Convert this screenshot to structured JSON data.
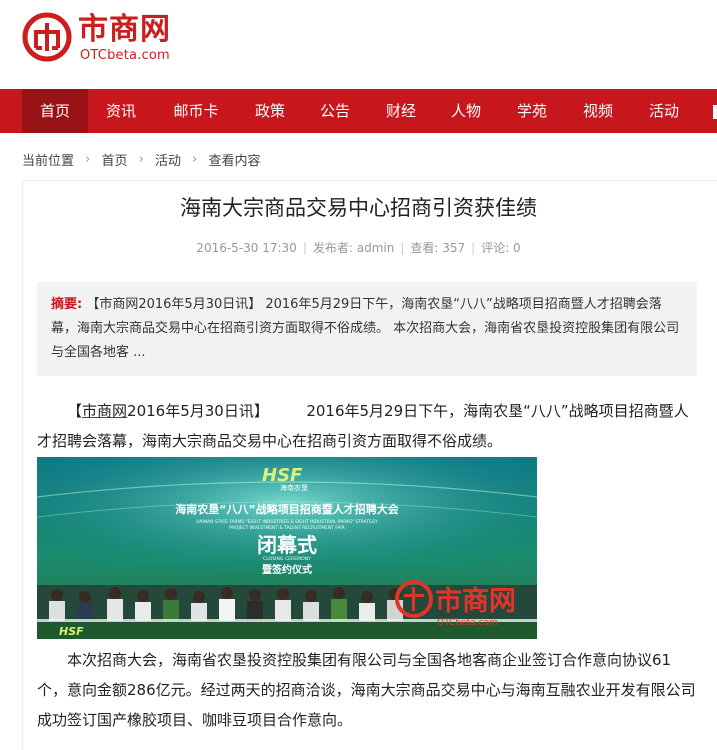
{
  "header": {
    "logo_text": "市商网",
    "logo_domain": "OTCbeta.com"
  },
  "nav": {
    "items": [
      "首页",
      "资讯",
      "邮币卡",
      "政策",
      "公告",
      "财经",
      "人物",
      "学苑",
      "视频",
      "活动"
    ]
  },
  "breadcrumb": {
    "label": "当前位置",
    "items": [
      "首页",
      "活动",
      "查看内容"
    ]
  },
  "article": {
    "title": "海南大宗商品交易中心招商引资获佳绩",
    "date": "2016-5-30 17:30",
    "author": "发布者: admin",
    "views": "查看: 357",
    "comments": "评论: 0",
    "abstract_label": "摘要:",
    "abstract_text": "【市商网2016年5月30日讯】 2016年5月29日下午，海南农垦“八八”战略项目招商暨人才招聘会落幕，海南大宗商品交易中心在招商引资方面取得不俗成绩。 本次招商大会，海南省农垦投资控股集团有限公司与全国各地客 ...",
    "para1_pre": "【",
    "para1_link": "市商网",
    "para1_post": "2016年5月30日讯】　　　2016年5月29日下午，海南农垦“八八”战略项目招商暨人才招聘会落幕，海南大宗商品交易中心在招商引资方面取得不俗成绩。",
    "photo": {
      "logo": "HSF",
      "logo_sub": "海南农垦",
      "banner_line1": "海南农垦“八八”战略项目招商暨人才招聘大会",
      "banner_en1": "HAINAN STATE FARMS \"EIGHT INDUSTRIES & EIGHT INDUSTRIAL PARKS\" STRATEGY",
      "banner_en2": "PROJECT INVESTMENT & TALENT RECRUITMENT FAIR",
      "closing": "闭幕式",
      "closing_en": "CLOSING CEREMONY",
      "signing": "暨签约仪式",
      "watermark": "市商网",
      "watermark_sub": "OTCbeta.com",
      "bottom_logo": "HSF"
    },
    "para2": "本次招商大会，海南省农垦投资控股集团有限公司与全国各地客商企业签订合作意向协议61个，意向金额286亿元。经过两天的招商洽谈，海南大宗商品交易中心与海南互融农业开发有限公司成功签订国产橡胶项目、咖啡豆项目合作意向。"
  },
  "colors": {
    "brand_red": "#c8161d",
    "nav_active": "#991316"
  }
}
